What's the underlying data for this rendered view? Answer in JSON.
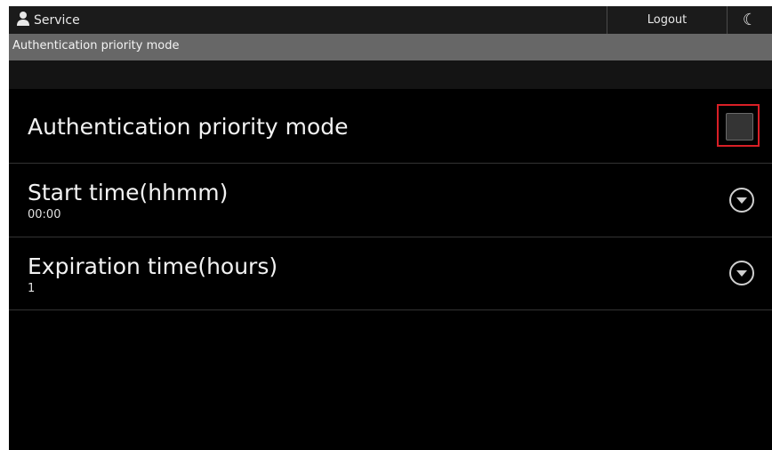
{
  "header": {
    "title": "Service",
    "logout_label": "Logout",
    "moon_icon": "moon-icon"
  },
  "breadcrumb": "Authentication priority mode",
  "settings": {
    "auth_priority": {
      "label": "Authentication priority mode",
      "checked": false
    },
    "start_time": {
      "label": "Start time(hhmm)",
      "value": "00:00"
    },
    "expiration_time": {
      "label": "Expiration time(hours)",
      "value": "1"
    }
  },
  "colors": {
    "highlight": "#d91f26",
    "background": "#000000",
    "header_bg": "#1b1b1b",
    "breadcrumb_bg": "#676767"
  }
}
